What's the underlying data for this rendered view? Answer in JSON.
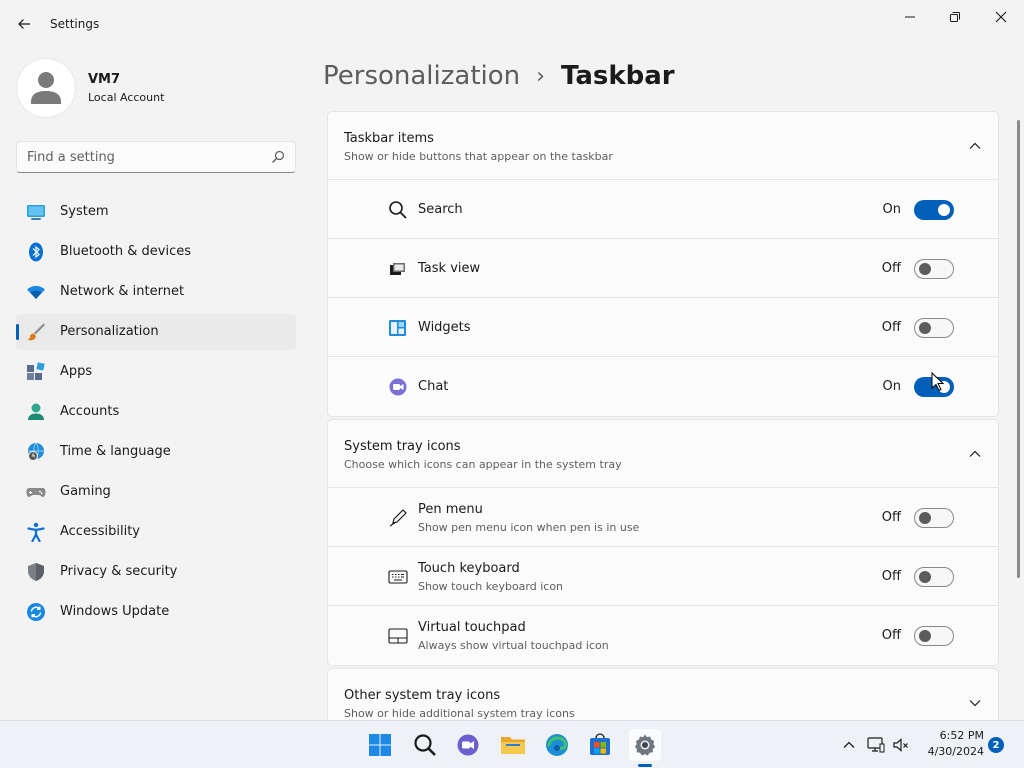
{
  "window": {
    "app_title": "Settings",
    "back_icon": "back-arrow-icon",
    "controls": [
      "minimize-icon",
      "restore-icon",
      "close-icon"
    ]
  },
  "profile": {
    "name": "VM7",
    "account_type": "Local Account"
  },
  "search": {
    "placeholder": "Find a setting",
    "value": ""
  },
  "sidebar": {
    "items": [
      {
        "label": "System",
        "icon": "system-icon",
        "active": false
      },
      {
        "label": "Bluetooth & devices",
        "icon": "bluetooth-icon",
        "active": false
      },
      {
        "label": "Network & internet",
        "icon": "wifi-icon",
        "active": false
      },
      {
        "label": "Personalization",
        "icon": "brush-icon",
        "active": true
      },
      {
        "label": "Apps",
        "icon": "apps-icon",
        "active": false
      },
      {
        "label": "Accounts",
        "icon": "accounts-icon",
        "active": false
      },
      {
        "label": "Time & language",
        "icon": "globe-clock-icon",
        "active": false
      },
      {
        "label": "Gaming",
        "icon": "gamepad-icon",
        "active": false
      },
      {
        "label": "Accessibility",
        "icon": "accessibility-icon",
        "active": false
      },
      {
        "label": "Privacy & security",
        "icon": "shield-icon",
        "active": false
      },
      {
        "label": "Windows Update",
        "icon": "update-icon",
        "active": false
      }
    ]
  },
  "breadcrumb": {
    "parent": "Personalization",
    "separator": "›",
    "current": "Taskbar"
  },
  "sections": [
    {
      "title": "Taskbar items",
      "subtitle": "Show or hide buttons that appear on the taskbar",
      "expanded": true,
      "rows": [
        {
          "label": "Search",
          "state": "On",
          "on": true,
          "icon": "search-icon"
        },
        {
          "label": "Task view",
          "state": "Off",
          "on": false,
          "icon": "task-view-icon"
        },
        {
          "label": "Widgets",
          "state": "Off",
          "on": false,
          "icon": "widgets-icon"
        },
        {
          "label": "Chat",
          "state": "On",
          "on": true,
          "icon": "chat-icon"
        }
      ]
    },
    {
      "title": "System tray icons",
      "subtitle": "Choose which icons can appear in the system tray",
      "expanded": true,
      "rows": [
        {
          "label": "Pen menu",
          "desc": "Show pen menu icon when pen is in use",
          "state": "Off",
          "on": false,
          "icon": "pen-icon"
        },
        {
          "label": "Touch keyboard",
          "desc": "Show touch keyboard icon",
          "state": "Off",
          "on": false,
          "icon": "keyboard-icon"
        },
        {
          "label": "Virtual touchpad",
          "desc": "Always show virtual touchpad icon",
          "state": "Off",
          "on": false,
          "icon": "touchpad-icon"
        }
      ]
    },
    {
      "title": "Other system tray icons",
      "subtitle": "Show or hide additional system tray icons",
      "expanded": false
    }
  ],
  "taskbar": {
    "apps": [
      "start-icon",
      "search-icon",
      "chat-icon",
      "file-explorer-icon",
      "edge-icon",
      "store-icon",
      "settings-icon"
    ],
    "active_app": "settings-icon",
    "tray_icons": [
      "chevron-up-icon",
      "network-icon",
      "volume-muted-icon"
    ],
    "time": "6:52 PM",
    "date": "4/30/2024",
    "notification_count": "2"
  },
  "colors": {
    "accent": "#005fb8",
    "background": "#f3f3f3",
    "card": "#fbfbfb"
  }
}
